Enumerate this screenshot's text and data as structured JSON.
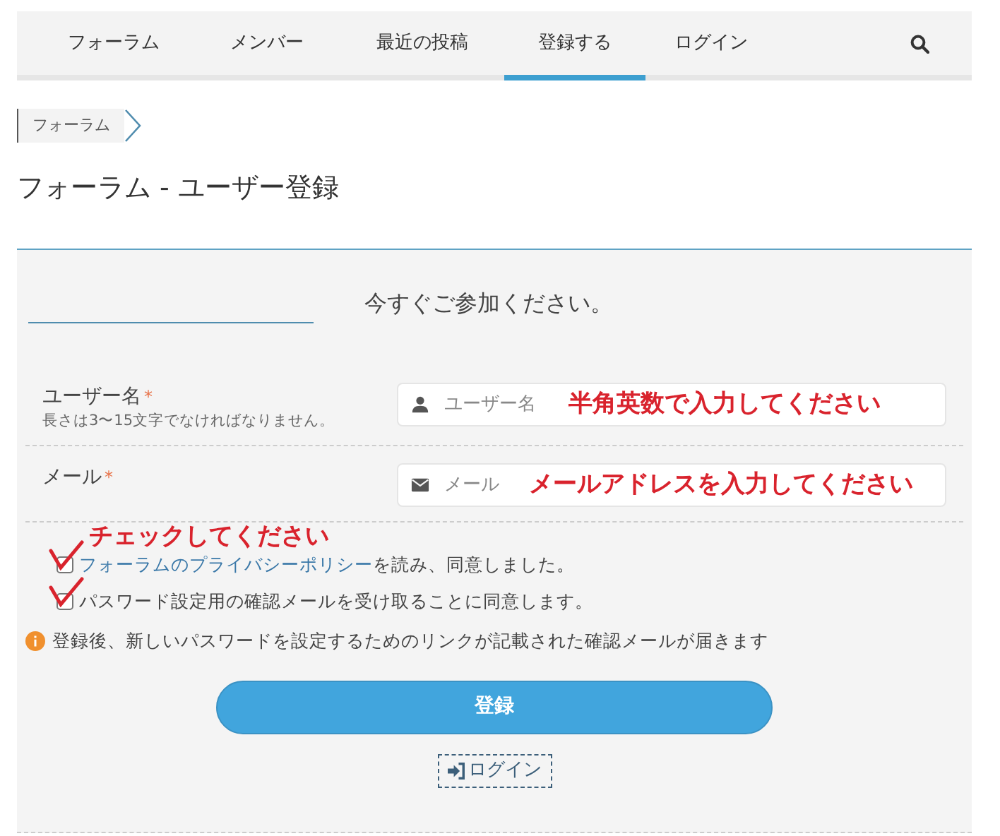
{
  "nav": {
    "items": [
      {
        "label": "フォーラム",
        "selected": false
      },
      {
        "label": "メンバー",
        "selected": false
      },
      {
        "label": "最近の投稿",
        "selected": false
      },
      {
        "label": "登録する",
        "selected": true
      },
      {
        "label": "ログイン",
        "selected": false
      }
    ]
  },
  "breadcrumb": [
    "フォーラム"
  ],
  "page_title": "フォーラム - ユーザー登録",
  "form": {
    "heading": "今すぐご参加ください。",
    "fields": [
      {
        "kind": "user",
        "label": "ユーザー名",
        "required_mark": "*",
        "hint": "長さは3〜15文字でなければなりません。",
        "placeholder": "ユーザー名",
        "annotation": "半角英数で入力してください"
      },
      {
        "kind": "mail",
        "label": "メール",
        "required_mark": "*",
        "placeholder": "メール",
        "annotation": "メールアドレスを入力してください"
      }
    ],
    "consent_annotation": "チェックしてください",
    "consents": [
      {
        "link": "フォーラムのプライバシーポリシー",
        "text": "を読み、同意しました。",
        "checked": false,
        "marked": true
      },
      {
        "text": "パスワード設定用の確認メールを受け取ることに同意します。",
        "checked": false,
        "marked": true
      }
    ],
    "info": "登録後、新しいパスワードを設定するためのリンクが記載された確認メールが届きます",
    "submit": "登録",
    "login_link": "ログイン"
  }
}
